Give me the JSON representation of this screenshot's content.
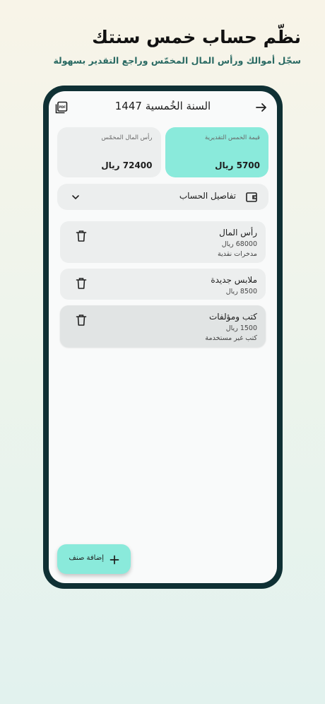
{
  "promo": {
    "headline": "نظّم حساب خمس سنتك",
    "subheadline": "سجّل أموالك ورأس المال المخمّس وراجع التقدير بسهولة"
  },
  "app": {
    "title": "السنة الخُمسية 1447",
    "back_icon": "arrow-right-icon",
    "pdf_icon": "pdf-export-icon"
  },
  "summary": {
    "zakat_label": "قيمة الخمس التقديرية",
    "zakat_value": "5700 ريال",
    "capital_label": "رأس المال المخمّس",
    "capital_value": "72400 ريال"
  },
  "details": {
    "label": "تفاصيل الحساب",
    "icon": "wallet-icon",
    "chevron": "chevron-down-icon"
  },
  "items": [
    {
      "name": "رأس المال",
      "amount": "68000 ريال",
      "desc": "مدخرات نقدية"
    },
    {
      "name": "ملابس جديدة",
      "amount": "8500 ريال",
      "desc": ""
    },
    {
      "name": "كتب ومؤلفات",
      "amount": "1500 ريال",
      "desc": "كتب غير مستخدمة"
    }
  ],
  "fab": {
    "label": "إضافة صنف"
  },
  "colors": {
    "accent": "#8aeadb",
    "phone_frame": "#0f3034",
    "subheadline": "#2a6a63"
  }
}
